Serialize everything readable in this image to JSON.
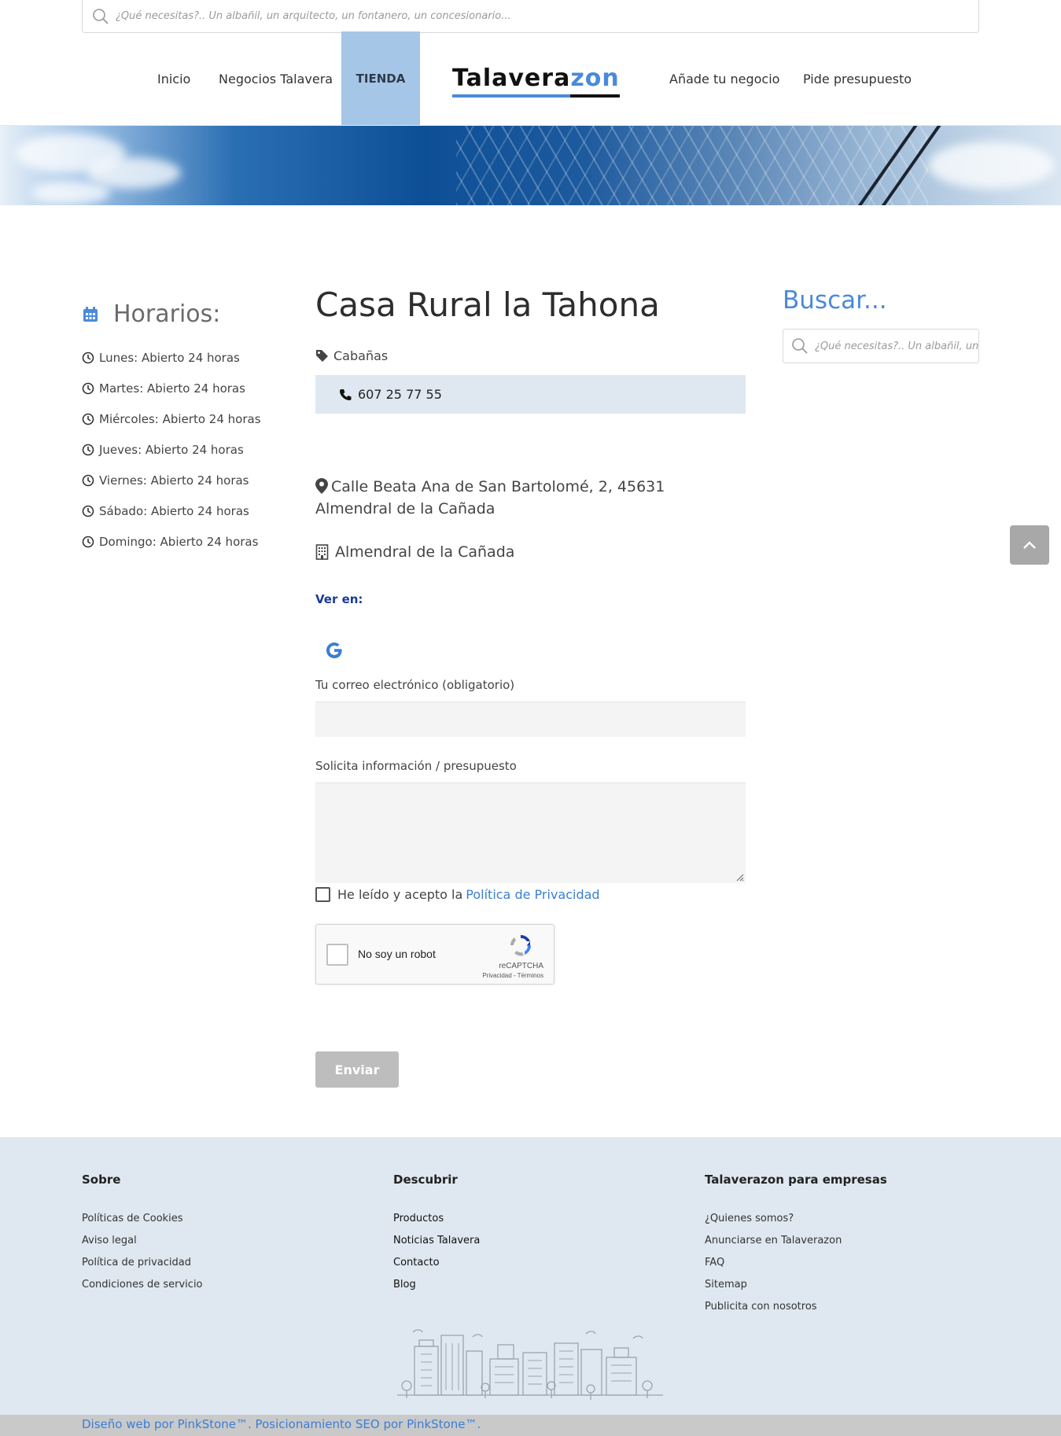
{
  "header": {
    "search_placeholder": "¿Qué necesitas?.. Un albañil, un arquitecto, un fontanero, un concesionario...",
    "nav": {
      "inicio": "Inicio",
      "negocios": "Negocios Talavera",
      "tienda": "TIENDA",
      "anade": "Añade tu negocio",
      "presupuesto": "Pide presupuesto"
    },
    "logo": {
      "part1": "Talavera",
      "part2": "zon"
    }
  },
  "hours": {
    "title": "Horarios:",
    "items": [
      "Lunes: Abierto 24 horas",
      "Martes: Abierto 24 horas",
      "Miércoles: Abierto 24 horas",
      "Jueves: Abierto 24 horas",
      "Viernes: Abierto 24 horas",
      "Sábado: Abierto 24 horas",
      "Domingo: Abierto 24 horas"
    ]
  },
  "business": {
    "name": "Casa Rural la Tahona",
    "category": "Cabañas",
    "phone": "607 25 77 55",
    "address": "Calle Beata Ana de San Bartolomé, 2, 45631 Almendral de la Cañada",
    "city": "Almendral de la Cañada",
    "see_on": "Ver en:"
  },
  "form": {
    "email_label": "Tu correo electrónico (obligatorio)",
    "message_label": "Solicita información / presupuesto",
    "consent_text": "He leído y acepto la",
    "consent_link": "Política de Privacidad",
    "captcha_label": "No soy un robot",
    "captcha_brand": "reCAPTCHA",
    "captcha_links": "Privacidad - Términos",
    "submit_label": "Enviar"
  },
  "sidebar": {
    "title": "Buscar...",
    "search_placeholder": "¿Qué necesitas?.. Un albañil, un arquitecto"
  },
  "footer": {
    "col1": {
      "title": "Sobre",
      "links": [
        "Políticas de Cookies",
        "Aviso legal",
        "Política de privacidad",
        "Condiciones de servicio"
      ]
    },
    "col2": {
      "title": "Descubrir",
      "links": [
        "Productos",
        "Noticias Talavera",
        "Contacto",
        "Blog"
      ]
    },
    "col3": {
      "title": "Talaverazon para empresas",
      "links": [
        "¿Quienes somos?",
        "Anunciarse en Talaverazon",
        "FAQ",
        "Sitemap",
        "Publicita con nosotros"
      ]
    },
    "credits": "Diseño web por PinkStone™. Posicionamiento SEO por PinkStone™."
  },
  "icons": {
    "search": "search-icon",
    "calendar": "calendar-icon",
    "clock": "clock-icon",
    "tag": "tag-icon",
    "phone": "phone-icon",
    "map_pin": "map-pin-icon",
    "building": "building-icon",
    "google": "google-icon",
    "back_to_top": "chevron-up-icon"
  },
  "colors": {
    "accent_blue": "#4a8ad9",
    "nav_active_bg": "#a6c6e8",
    "phone_box_bg": "#dfe8f0",
    "footer_bg": "#dfe8f0",
    "submit_bg": "#bdbdbd",
    "link_blue": "#3a7fd4"
  }
}
